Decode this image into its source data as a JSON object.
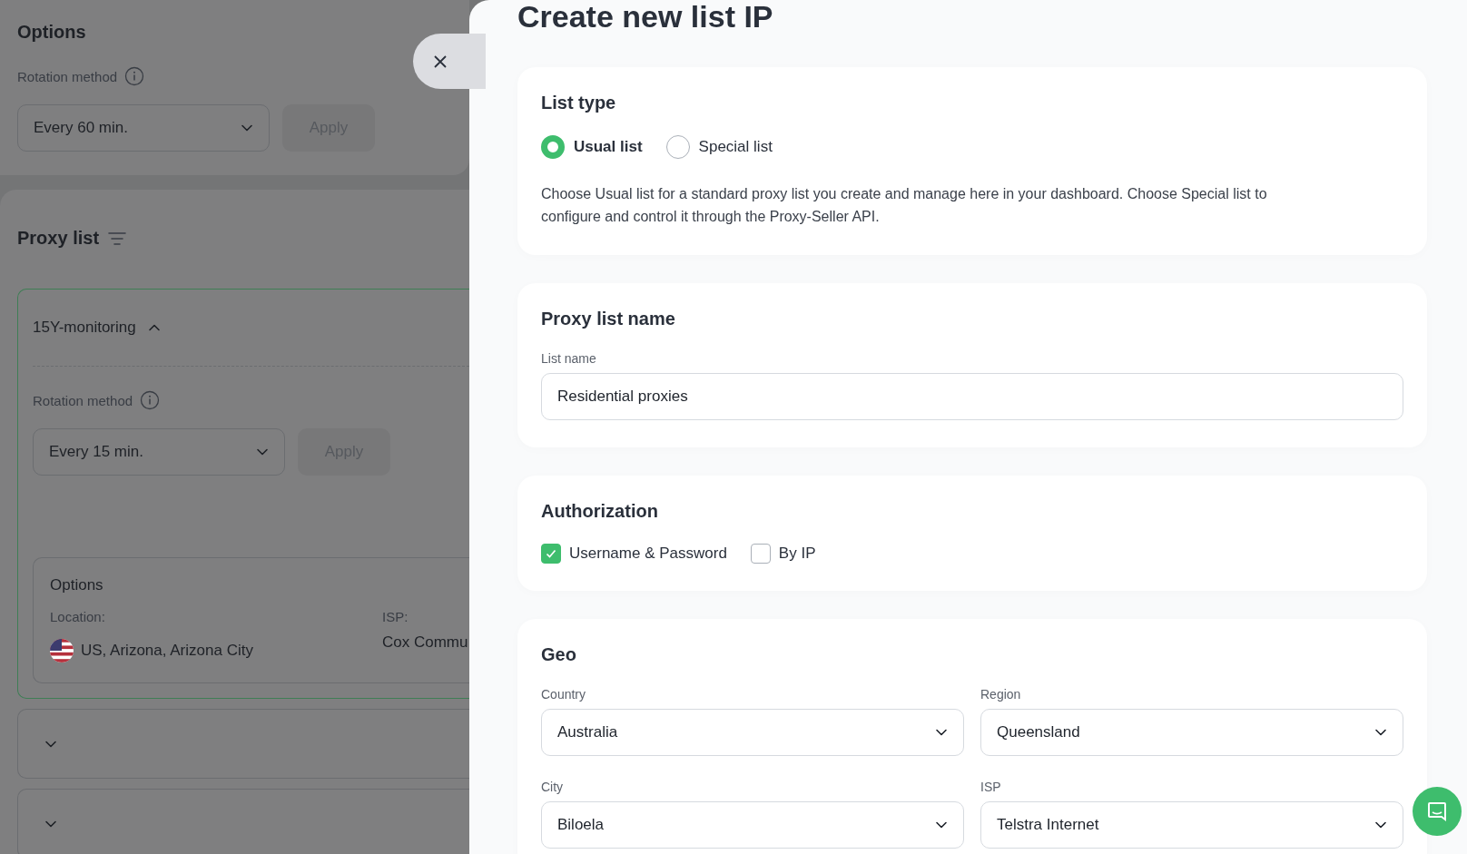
{
  "background": {
    "options": {
      "title": "Options",
      "rotation_label": "Rotation method",
      "select_value": "Every 60 min.",
      "apply": "Apply"
    },
    "proxy_list": {
      "title": "Proxy list",
      "groups": [
        {
          "name": "15Y-monitoring",
          "expanded": true,
          "rotation_label": "Rotation method",
          "select_value": "Every 15 min.",
          "apply": "Apply",
          "options": {
            "title": "Options",
            "location_label": "Location:",
            "location": "US, Arizona, Arizona City",
            "isp_label": "ISP:",
            "isp": "Cox Commu"
          }
        },
        {
          "expanded": false
        },
        {
          "expanded": false
        }
      ]
    }
  },
  "modal": {
    "title": "Create new list IP",
    "list_type": {
      "title": "List type",
      "options": [
        {
          "label": "Usual list",
          "selected": true
        },
        {
          "label": "Special list",
          "selected": false
        }
      ],
      "description": "Choose Usual list for a standard proxy list you create and manage here in your dashboard. Choose Special list to configure and control it through the Proxy-Seller API."
    },
    "name_section": {
      "title": "Proxy list name",
      "field_label": "List name",
      "value": "Residential proxies"
    },
    "authorization": {
      "title": "Authorization",
      "options": [
        {
          "label": "Username & Password",
          "checked": true
        },
        {
          "label": "By IP",
          "checked": false
        }
      ]
    },
    "geo": {
      "title": "Geo",
      "fields": [
        {
          "label": "Country",
          "value": "Australia"
        },
        {
          "label": "Region",
          "value": "Queensland"
        },
        {
          "label": "City",
          "value": "Biloela"
        },
        {
          "label": "ISP",
          "value": "Telstra Internet"
        }
      ]
    }
  }
}
